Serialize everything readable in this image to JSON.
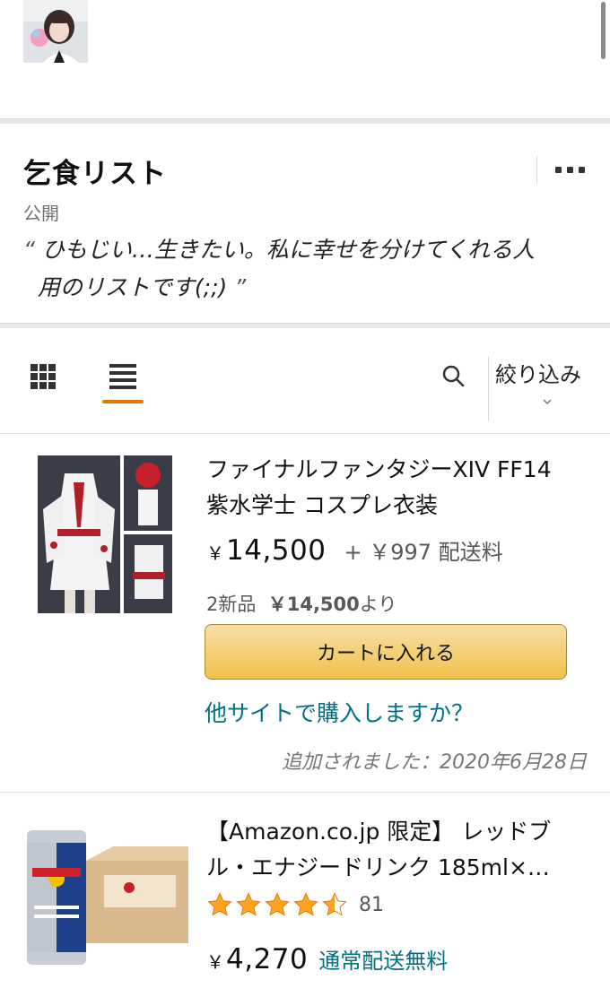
{
  "list": {
    "title": "乞食リスト",
    "visibility": "公開",
    "description_line1": "ひもじい…生きたい。私に幸せを分けてくれる人",
    "description_line2": "用のリストです(;;)",
    "open_quote": "“",
    "close_quote": "”"
  },
  "toolbar": {
    "filter_label": "絞り込み",
    "active_view": "list"
  },
  "items": [
    {
      "title_line1": "ファイナルファンタジーXIV FF14",
      "title_line2": "紫水学士 コスプレ衣装",
      "yen": "￥",
      "price": "14,500",
      "shipping": "+ ￥997 配送料",
      "offers_prefix": "2新品",
      "offers_price": "￥14,500",
      "offers_suffix": "より",
      "cart_label": "カートに入れる",
      "other_site_label": "他サイトで購入しますか？",
      "added_label": "追加されました：2020年6月28日"
    },
    {
      "title_line1": "【Amazon.co.jp 限定】 レッドブ",
      "title_line2": "ル・エナジードリンク 185ml×…",
      "rating": 4.5,
      "rating_count": "81",
      "yen": "￥",
      "price": "4,270",
      "free_shipping": "通常配送無料"
    }
  ],
  "colors": {
    "accent": "#e77600",
    "link": "#007185",
    "cart_button": "#f0c14b",
    "star": "#ffa41c"
  }
}
